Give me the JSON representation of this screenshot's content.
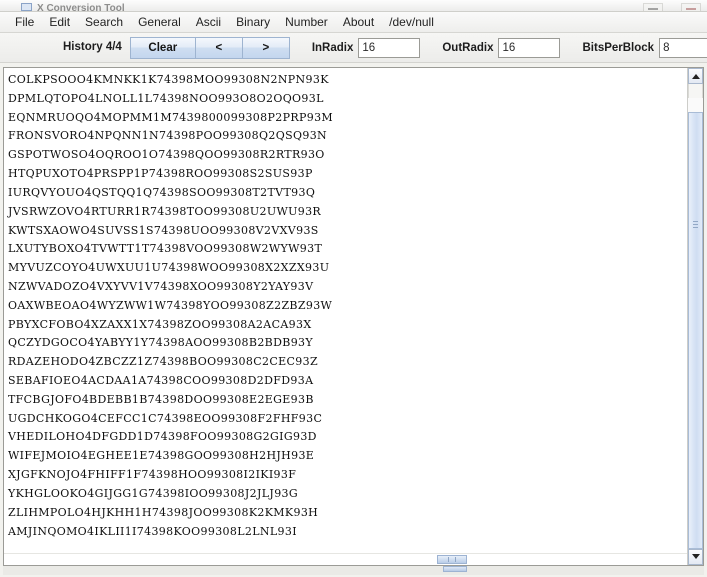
{
  "window": {
    "title": "X Conversion Tool",
    "controls": [
      {
        "name": "minimize",
        "glyph": "_"
      },
      {
        "name": "maximize",
        "glyph": "□"
      }
    ]
  },
  "menubar": {
    "items": [
      {
        "label": "File"
      },
      {
        "label": "Edit"
      },
      {
        "label": "Search"
      },
      {
        "label": "General"
      },
      {
        "label": "Ascii"
      },
      {
        "label": "Binary"
      },
      {
        "label": "Number"
      },
      {
        "label": "About"
      },
      {
        "label": "/dev/null"
      }
    ]
  },
  "toolbar": {
    "history_label": "History 4/4",
    "clear_label": "Clear",
    "prev_label": "<",
    "next_label": ">",
    "inradix_label": "InRadix",
    "inradix_value": "16",
    "outradix_label": "OutRadix",
    "outradix_value": "16",
    "bitsperblock_label": "BitsPerBlock",
    "bitsperblock_value": "8",
    "placeholder": ""
  },
  "textarea": {
    "lines": [
      "COLKPSOOO4KMNKK1K74398MOO99308N2NPN93K",
      "DPMLQTOPO4LNOLL1L74398NOO993O8O2OQO93L",
      "EQNMRUOQO4MOPMM1M7439800099308P2PRP93M",
      "FRONSVORO4NPQNN1N74398POO99308Q2QSQ93N",
      "GSPOTWOSO4OQROO1O74398QOO99308R2RTR93O",
      "HTQPUXOTO4PRSPP1P74398ROO99308S2SUS93P",
      "IURQVYOUO4QSTQQ1Q74398SOO99308T2TVT93Q",
      "JVSRWZOVO4RTURR1R74398TOO99308U2UWU93R",
      "KWTSXAOWO4SUVSS1S74398UOO99308V2VXV93S",
      "LXUTYBOXO4TVWTT1T74398VOO99308W2WYW93T",
      "MYVUZCOYO4UWXUU1U74398WOO99308X2XZX93U",
      "NZWVADOZO4VXYVV1V74398XOO99308Y2YAY93V",
      "OAXWBEOAO4WYZWW1W74398YOO99308Z2ZBZ93W",
      "PBYXCFOBO4XZAXX1X74398ZOO99308A2ACA93X",
      "QCZYDGOCO4YABYY1Y74398AOO99308B2BDB93Y",
      "RDAZEHODO4ZBCZZ1Z74398BOO99308C2CEC93Z",
      "SEBAFIOEO4ACDAA1A74398COO99308D2DFD93A",
      "TFCBGJOFO4BDEBB1B74398DOO99308E2EGE93B",
      "UGDCHKOGO4CEFCC1C74398EOO99308F2FHF93C",
      "VHEDILOHO4DFGDD1D74398FOO99308G2GIG93D",
      "WIFEJMOIO4EGHEE1E74398GOO99308H2HJH93E",
      "XJGFKNOJO4FHIFF1F74398HOO99308I2IKI93F",
      "YKHGLOOKO4GIJGG1G74398IOO99308J2JLJ93G",
      "ZLIHMPOLO4HJKHH1H74398JOO99308K2KMK93H",
      "AMJINQOMO4IKLII1I74398KOO99308L2LNL93I"
    ]
  },
  "scrollbars": {
    "vertical": {
      "up_arrow": "▲",
      "down_arrow": "▼"
    },
    "horizontal": {}
  },
  "colors": {
    "window_bg": "#f2f2ee",
    "toolbar_bg": "#f0f0ee",
    "button_face": "#cfdef1",
    "text_fg": "#101010",
    "field_bg": "#ffffff",
    "scroll_thumb": "#cfddf2"
  }
}
